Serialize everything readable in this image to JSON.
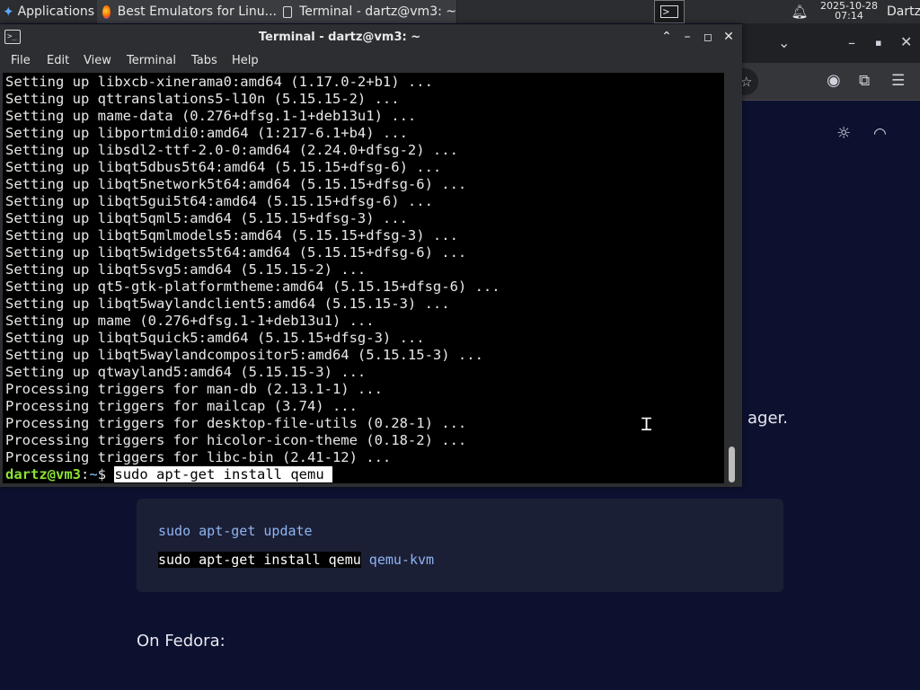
{
  "panel": {
    "apps_label": "Applications",
    "tasks": [
      {
        "label": "Best Emulators for Linu...",
        "icon": "firefox-icon"
      },
      {
        "label": "Terminal - dartz@vm3: ~",
        "icon": "terminal-icon"
      }
    ],
    "clock_date": "2025-10-28",
    "clock_time": "07:14",
    "user": "Dartz"
  },
  "terminal": {
    "title": "Terminal - dartz@vm3: ~",
    "menu": [
      "File",
      "Edit",
      "View",
      "Terminal",
      "Tabs",
      "Help"
    ],
    "output": [
      "Setting up libxcb-xinerama0:amd64 (1.17.0-2+b1) ...",
      "Setting up qttranslations5-l10n (5.15.15-2) ...",
      "Setting up mame-data (0.276+dfsg.1-1+deb13u1) ...",
      "Setting up libportmidi0:amd64 (1:217-6.1+b4) ...",
      "Setting up libsdl2-ttf-2.0-0:amd64 (2.24.0+dfsg-2) ...",
      "Setting up libqt5dbus5t64:amd64 (5.15.15+dfsg-6) ...",
      "Setting up libqt5network5t64:amd64 (5.15.15+dfsg-6) ...",
      "Setting up libqt5gui5t64:amd64 (5.15.15+dfsg-6) ...",
      "Setting up libqt5qml5:amd64 (5.15.15+dfsg-3) ...",
      "Setting up libqt5qmlmodels5:amd64 (5.15.15+dfsg-3) ...",
      "Setting up libqt5widgets5t64:amd64 (5.15.15+dfsg-6) ...",
      "Setting up libqt5svg5:amd64 (5.15.15-2) ...",
      "Setting up qt5-gtk-platformtheme:amd64 (5.15.15+dfsg-6) ...",
      "Setting up libqt5waylandclient5:amd64 (5.15.15-3) ...",
      "Setting up mame (0.276+dfsg.1-1+deb13u1) ...",
      "Setting up libqt5quick5:amd64 (5.15.15+dfsg-3) ...",
      "Setting up libqt5waylandcompositor5:amd64 (5.15.15-3) ...",
      "Setting up qtwayland5:amd64 (5.15.15-3) ...",
      "Processing triggers for man-db (2.13.1-1) ...",
      "Processing triggers for mailcap (3.74) ...",
      "Processing triggers for desktop-file-utils (0.28-1) ...",
      "Processing triggers for hicolor-icon-theme (0.18-2) ...",
      "Processing triggers for libc-bin (2.41-12) ..."
    ],
    "prompt_user": "dartz@vm3",
    "prompt_colon": ":",
    "prompt_path": "~",
    "prompt_symbol": "$ ",
    "command": "sudo apt-get install qemu "
  },
  "browser": {
    "para_fragment": "ager.",
    "code_line1": "sudo apt-get update",
    "code_line2_selected": "sudo apt-get install qemu",
    "code_line2_rest": " qemu-kvm",
    "fedora_heading": "On Fedora:"
  }
}
